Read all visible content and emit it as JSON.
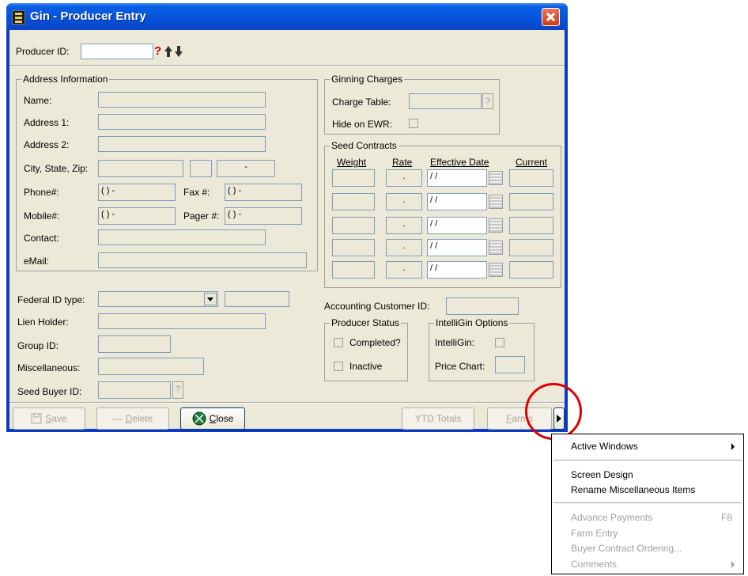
{
  "window": {
    "title": "Gin - Producer Entry"
  },
  "producer_id": {
    "label": "Producer ID:",
    "value": "",
    "help": "?"
  },
  "address": {
    "caption": "Address Information",
    "name_label": "Name:",
    "address1_label": "Address 1:",
    "address2_label": "Address 2:",
    "city_label": "City, State, Zip:",
    "zip_value": "-",
    "phone_label": "Phone#:",
    "phone_value": "(  )  -",
    "fax_label": "Fax #:",
    "fax_value": "(  )  -",
    "mobile_label": "Mobile#:",
    "mobile_value": "(  )  -",
    "pager_label": "Pager #:",
    "pager_value": "(  )  -",
    "contact_label": "Contact:",
    "email_label": "eMail:"
  },
  "ginning": {
    "caption": "Ginning Charges",
    "charge_table_label": "Charge Table:",
    "help": "?",
    "hide_ewr_label": "Hide on EWR:"
  },
  "seed_contracts": {
    "caption": "Seed Contracts",
    "headers": [
      "Weight",
      "Rate",
      "Effective Date",
      "Current"
    ],
    "rows": [
      {
        "rate": ".",
        "date": "/ /"
      },
      {
        "rate": ".",
        "date": "/ /"
      },
      {
        "rate": ".",
        "date": "/ /"
      },
      {
        "rate": ".",
        "date": "/ /"
      },
      {
        "rate": ".",
        "date": "/ /"
      }
    ]
  },
  "federal": {
    "label": "Federal ID type:"
  },
  "lien_label": "Lien Holder:",
  "group_label": "Group ID:",
  "misc_label": "Miscellaneous:",
  "seed_buyer": {
    "label": "Seed Buyer ID:",
    "help": "?"
  },
  "accounting_label": "Accounting Customer ID:",
  "producer_status": {
    "caption": "Producer Status",
    "completed": "Completed?",
    "inactive": "Inactive"
  },
  "intelligin": {
    "caption": "IntelliGin Options",
    "intelligin_label": "IntelliGin:",
    "price_chart_label": "Price Chart:"
  },
  "buttons": {
    "save_prefix": "",
    "save_u": "S",
    "save_rest": "ave",
    "delete_prefix": "",
    "delete_u": "D",
    "delete_rest": "elete",
    "close_prefix": "",
    "close_u": "C",
    "close_rest": "lose",
    "ytd": "YTD Totals",
    "farms_prefix": "",
    "farms_u": "F",
    "farms_rest": "arms"
  },
  "menu": {
    "items": [
      {
        "label": "Active Windows",
        "shortcut": "",
        "disabled": false,
        "submenu": true
      },
      {
        "label": "Screen Design",
        "shortcut": "",
        "disabled": false,
        "submenu": false
      },
      {
        "label": "Rename Miscellaneous Items",
        "shortcut": "",
        "disabled": false,
        "submenu": false
      },
      {
        "label": "Advance Payments",
        "shortcut": "F8",
        "disabled": true,
        "submenu": false
      },
      {
        "label": "Farm Entry",
        "shortcut": "",
        "disabled": true,
        "submenu": false
      },
      {
        "label": "Buyer Contract Ordering...",
        "shortcut": "",
        "disabled": true,
        "submenu": false
      },
      {
        "label": "Comments",
        "shortcut": "",
        "disabled": true,
        "submenu": true
      }
    ]
  },
  "colors": {
    "title_bar": "#0553da",
    "window_bg": "#ece9d8",
    "highlight_circle": "#e00000"
  }
}
